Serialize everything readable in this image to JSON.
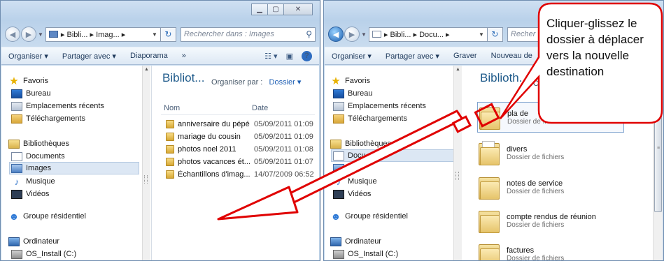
{
  "left_window": {
    "breadcrumb": "▸ Bibli... ▸ Imag... ▸",
    "search_placeholder": "Rechercher dans : Images",
    "toolbar": {
      "organize": "Organiser ▾",
      "share": "Partager avec ▾",
      "slideshow": "Diaporama",
      "more": "»"
    },
    "nav": {
      "favorites": "Favoris",
      "desktop": "Bureau",
      "recent": "Emplacements récents",
      "downloads": "Téléchargements",
      "libraries": "Bibliothèques",
      "documents": "Documents",
      "images": "Images",
      "music": "Musique",
      "videos": "Vidéos",
      "homegroup": "Groupe résidentiel",
      "computer": "Ordinateur",
      "drive": "OS_Install (C:)"
    },
    "library_title": "Bibliot...",
    "arrange_label": "Organiser par :",
    "arrange_value": "Dossier ▾",
    "columns": {
      "name": "Nom",
      "date": "Date"
    },
    "files": [
      {
        "name": "anniversaire du pépé",
        "date": "05/09/2011 01:09"
      },
      {
        "name": "mariage du cousin",
        "date": "05/09/2011 01:09"
      },
      {
        "name": "photos noel 2011",
        "date": "05/09/2011 01:08"
      },
      {
        "name": "photos vacances ét...",
        "date": "05/09/2011 01:07"
      },
      {
        "name": "Échantillons d'imag...",
        "date": "14/07/2009 06:52"
      }
    ]
  },
  "right_window": {
    "breadcrumb": "▸ Bibli... ▸ Docu... ▸",
    "search_placeholder": "Recher",
    "toolbar": {
      "organize": "Organiser ▾",
      "share": "Partager avec ▾",
      "burn": "Graver",
      "new_folder": "Nouveau de"
    },
    "nav": {
      "favorites": "Favoris",
      "desktop": "Bureau",
      "recent": "Emplacements récents",
      "downloads": "Téléchargements",
      "libraries": "Bibliothèques",
      "documents": "Docu",
      "images": "ges",
      "music": "Musique",
      "videos": "Vidéos",
      "homegroup": "Groupe résidentiel",
      "computer": "Ordinateur",
      "drive": "OS_Install (C:)"
    },
    "library_title": "Biblioth...",
    "arrange_label": "C",
    "folders": [
      {
        "name": "pla",
        "name_cut": "de",
        "type": "Dossier de fi"
      },
      {
        "name": "divers",
        "type": "Dossier de fichiers"
      },
      {
        "name": "notes de service",
        "type": "Dossier de fichiers"
      },
      {
        "name": "compte rendus de réunion",
        "type": "Dossier de fichiers"
      },
      {
        "name": "factures",
        "type": "Dossier de fichiers"
      }
    ]
  },
  "callout": {
    "text": "Cliquer-glissez le dossier à déplacer vers la nouvelle destination",
    "color": "#e00000"
  },
  "icons": [
    "back-arrow-icon",
    "forward-arrow-icon",
    "folder-icon",
    "refresh-icon",
    "search-icon",
    "view-icon",
    "preview-pane-icon",
    "help-icon",
    "star-icon",
    "desktop-icon",
    "recent-places-icon",
    "downloads-icon",
    "libraries-icon",
    "documents-icon",
    "images-icon",
    "music-icon",
    "videos-icon",
    "homegroup-icon",
    "computer-icon",
    "drive-icon"
  ]
}
